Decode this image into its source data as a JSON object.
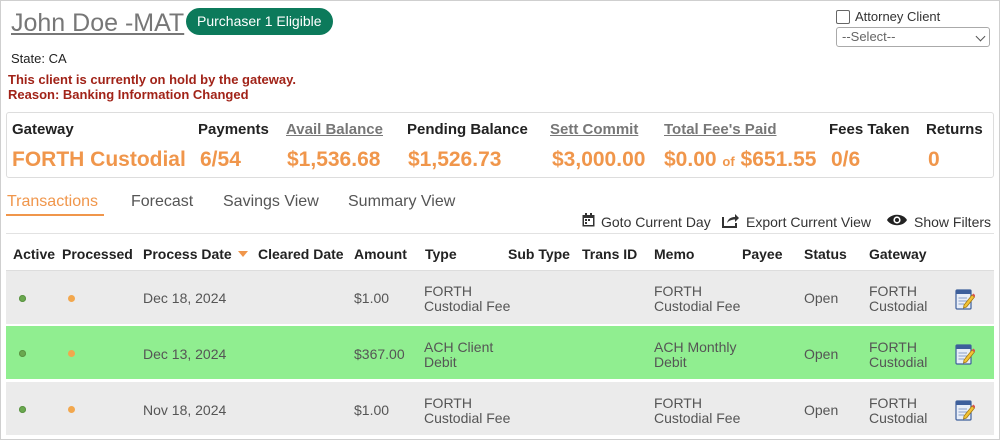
{
  "header": {
    "client_name": "John Doe -MAT",
    "badge": "Purchaser 1 Eligible",
    "state": "State: CA",
    "hold_line1": "This client is currently on hold by the gateway.",
    "hold_line2": "Reason: Banking Information Changed",
    "attorney_label": "Attorney Client",
    "attorney_checked": false,
    "select_value": "--Select--"
  },
  "summary": {
    "gateway_label": "Gateway",
    "gateway_value": "FORTH Custodial",
    "payments_label": "Payments",
    "payments_value": "6/54",
    "avail_label": "Avail Balance",
    "avail_value": "$1,536.68",
    "pending_label": "Pending Balance",
    "pending_value": "$1,526.73",
    "sett_label": "Sett Commit",
    "sett_value": "$3,000.00",
    "fees_paid_label": "Total Fee's Paid",
    "fees_paid_value": "$0.00",
    "fees_of": "of",
    "fees_total": "$651.55",
    "fees_taken_label": "Fees Taken",
    "fees_taken_value": "0/6",
    "returns_label": "Returns",
    "returns_value": "0",
    "accent_color": "#f0964b"
  },
  "tabs": [
    {
      "label": "Transactions",
      "active": true
    },
    {
      "label": "Forecast",
      "active": false
    },
    {
      "label": "Savings View",
      "active": false
    },
    {
      "label": "Summary View",
      "active": false
    }
  ],
  "toolbar": {
    "goto_label": "Goto Current Day",
    "export_label": "Export Current View",
    "filters_label": "Show Filters"
  },
  "table": {
    "columns": [
      "Active",
      "Processed",
      "Process Date",
      "Cleared Date",
      "Amount",
      "Type",
      "Sub Type",
      "Trans ID",
      "Memo",
      "Payee",
      "Status",
      "Gateway"
    ],
    "rows": [
      {
        "process_date": "Dec 18, 2024",
        "cleared_date": "",
        "amount": "$1.00",
        "type_l1": "FORTH",
        "type_l2": "Custodial Fee",
        "memo_l1": "FORTH",
        "memo_l2": "Custodial Fee",
        "status": "Open",
        "gateway_l1": "FORTH",
        "gateway_l2": "Custodial",
        "bg": "#ebebeb"
      },
      {
        "process_date": "Dec 13, 2024",
        "cleared_date": "",
        "amount": "$367.00",
        "type_l1": "ACH Client",
        "type_l2": "Debit",
        "memo_l1": "ACH Monthly",
        "memo_l2": "Debit",
        "status": "Open",
        "gateway_l1": "FORTH",
        "gateway_l2": "Custodial",
        "bg": "#90ee90"
      },
      {
        "process_date": "Nov 18, 2024",
        "cleared_date": "",
        "amount": "$1.00",
        "type_l1": "FORTH",
        "type_l2": "Custodial Fee",
        "memo_l1": "FORTH",
        "memo_l2": "Custodial Fee",
        "status": "Open",
        "gateway_l1": "FORTH",
        "gateway_l2": "Custodial",
        "bg": "#ebebeb"
      }
    ]
  }
}
